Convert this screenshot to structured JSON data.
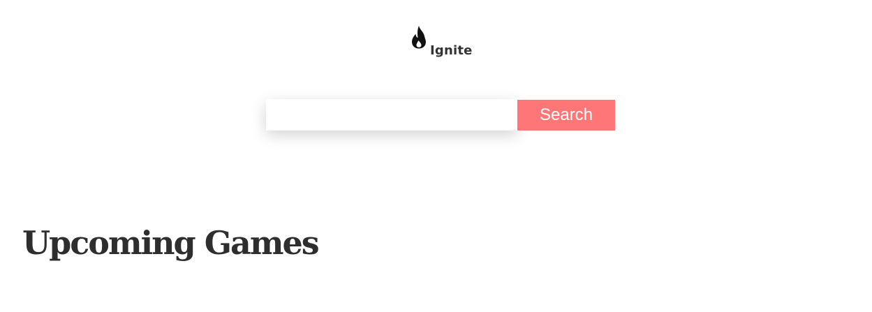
{
  "header": {
    "logo_icon": "flame-icon",
    "brand_name": "Ignite"
  },
  "search": {
    "value": "",
    "placeholder": "",
    "button_label": "Search"
  },
  "main": {
    "section_title": "Upcoming Games"
  },
  "colors": {
    "accent": "#ff7676",
    "text": "#333333",
    "background": "#ffffff"
  }
}
